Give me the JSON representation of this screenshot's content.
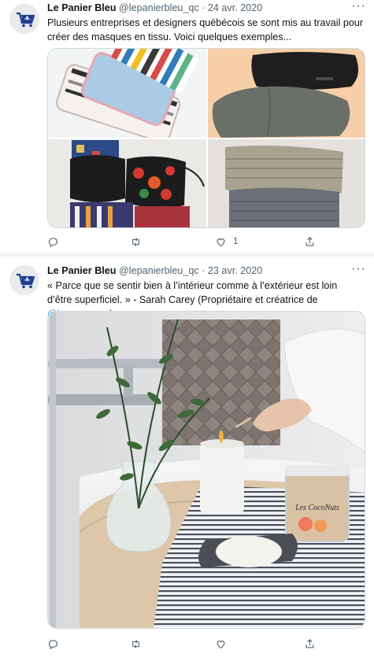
{
  "tweets": [
    {
      "author_name": "Le Panier Bleu",
      "handle": "@lepanierbleu_qc",
      "separator": "·",
      "date": "24 avr. 2020",
      "more": "···",
      "text": "Plusieurs entreprises et designers québécois se sont mis au travail pour créer des masques en tissu. Voici quelques exemples...",
      "like_count": "1"
    },
    {
      "author_name": "Le Panier Bleu",
      "handle": "@lepanierbleu_qc",
      "separator": "·",
      "date": "23 avr. 2020",
      "more": "···",
      "text_before_link": "« Parce que se sentir bien à l’intérieur comme à l’extérieur est loin d’être superficiel. » - Sarah Carey (Propriétaire et créatrice de ",
      "mention": "@lescoconuts",
      "text_after_link": ")",
      "jar_label": "Les CocoNuts"
    }
  ],
  "icons": [
    "reply-icon",
    "retweet-icon",
    "like-icon",
    "share-icon",
    "more-icon",
    "panier-bleu-logo"
  ],
  "colors": {
    "accent": "#1d9bf0",
    "secondary_text": "#536471",
    "brand_blue": "#1e3f8f"
  }
}
